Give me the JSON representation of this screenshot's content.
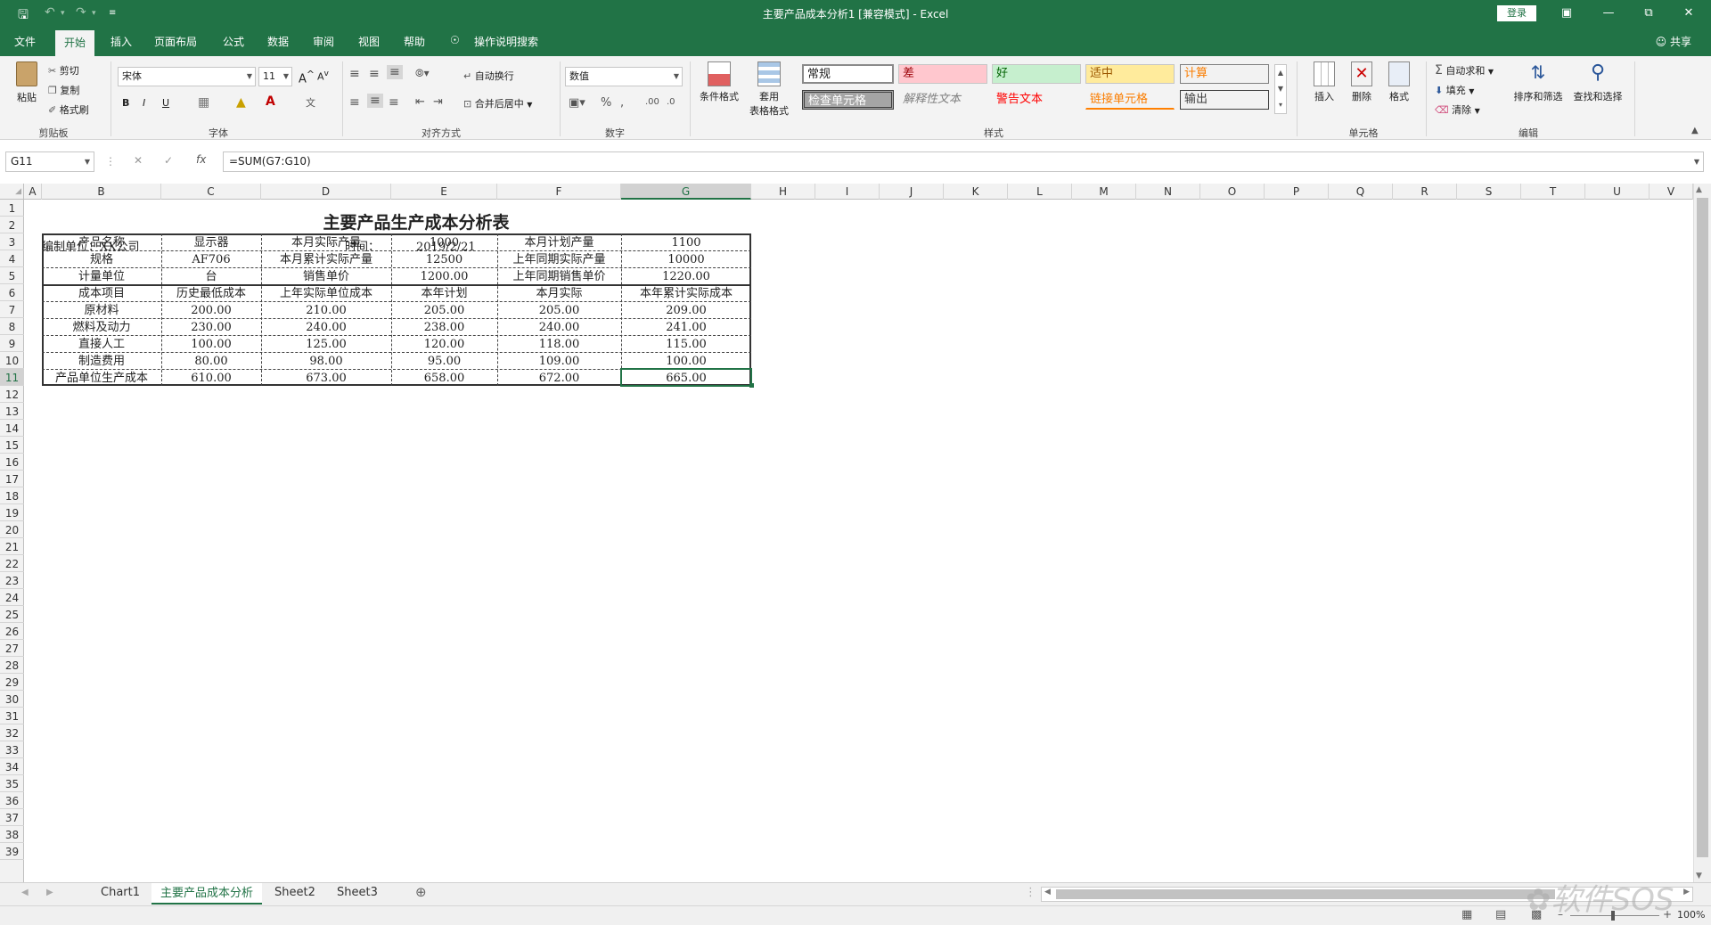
{
  "titlebar": {
    "title": "主要产品成本分析1  [兼容模式]  -  Excel",
    "login": "登录"
  },
  "tabs": [
    "文件",
    "开始",
    "插入",
    "页面布局",
    "公式",
    "数据",
    "审阅",
    "视图",
    "帮助"
  ],
  "tell_me": "操作说明搜索",
  "share": "共享",
  "ribbon": {
    "clipboard": {
      "paste": "粘贴",
      "cut": "剪切",
      "copy": "复制",
      "painter": "格式刷",
      "label": "剪贴板"
    },
    "font": {
      "name": "宋体",
      "size": "11",
      "label": "字体",
      "bold": "B",
      "italic": "I",
      "underline": "U"
    },
    "alignment": {
      "wrap": "自动换行",
      "merge": "合并后居中",
      "label": "对齐方式"
    },
    "number": {
      "format": "数值",
      "label": "数字"
    },
    "styles": {
      "cond_format": "条件格式",
      "table_format_1": "套用",
      "table_format_2": "表格格式",
      "normal": "常规",
      "bad": "差",
      "good": "好",
      "neutral": "适中",
      "calc": "计算",
      "check": "检查单元格",
      "explanatory": "解释性文本",
      "warning": "警告文本",
      "linked": "链接单元格",
      "output": "输出",
      "label": "样式"
    },
    "cells": {
      "insert": "插入",
      "delete": "删除",
      "format": "格式",
      "label": "单元格"
    },
    "editing": {
      "autosum": "自动求和",
      "fill": "填充",
      "clear": "清除",
      "sort": "排序和筛选",
      "find": "查找和选择",
      "label": "编辑"
    }
  },
  "formula_bar": {
    "name_box": "G11",
    "fx": "fx",
    "formula": "=SUM(G7:G10)"
  },
  "columns": [
    "A",
    "B",
    "C",
    "D",
    "E",
    "F",
    "G",
    "H",
    "I",
    "J",
    "K",
    "L",
    "M",
    "N",
    "O",
    "P",
    "Q",
    "R",
    "S",
    "T",
    "U",
    "V"
  ],
  "rows": [
    "1",
    "2",
    "3",
    "4",
    "5",
    "6",
    "7",
    "8",
    "9",
    "10",
    "11",
    "12",
    "13",
    "14",
    "15",
    "16",
    "17",
    "18",
    "19",
    "20",
    "21",
    "22",
    "23",
    "24",
    "25",
    "26",
    "27",
    "28",
    "29",
    "30",
    "31",
    "32",
    "33",
    "34",
    "35",
    "36",
    "37",
    "38",
    "39"
  ],
  "sheet": {
    "title": "主要产品生产成本分析表",
    "unit": "编制单位：XX公司",
    "time_label": "时间：",
    "time_value": "2019/2/21",
    "info_rows": [
      [
        "产品名称",
        "显示器",
        "本月实际产量",
        "1000",
        "本月计划产量",
        "1100"
      ],
      [
        "规格",
        "AF706",
        "本月累计实际产量",
        "12500",
        "上年同期实际产量",
        "10000"
      ],
      [
        "计量单位",
        "台",
        "销售单价",
        "1200.00",
        "上年同期销售单价",
        "1220.00"
      ]
    ],
    "cost_header": [
      "成本项目",
      "历史最低成本",
      "上年实际单位成本",
      "本年计划",
      "本月实际",
      "本年累计实际成本"
    ],
    "cost_rows": [
      [
        "原材料",
        "200.00",
        "210.00",
        "205.00",
        "205.00",
        "209.00"
      ],
      [
        "燃料及动力",
        "230.00",
        "240.00",
        "238.00",
        "240.00",
        "241.00"
      ],
      [
        "直接人工",
        "100.00",
        "125.00",
        "120.00",
        "118.00",
        "115.00"
      ],
      [
        "制造费用",
        "80.00",
        "98.00",
        "95.00",
        "109.00",
        "100.00"
      ],
      [
        "产品单位生产成本",
        "610.00",
        "673.00",
        "658.00",
        "672.00",
        "665.00"
      ]
    ]
  },
  "sheet_tabs": [
    "Chart1",
    "主要产品成本分析",
    "Sheet2",
    "Sheet3"
  ],
  "status": {
    "zoom": "100%"
  },
  "watermark": "软件SOS"
}
